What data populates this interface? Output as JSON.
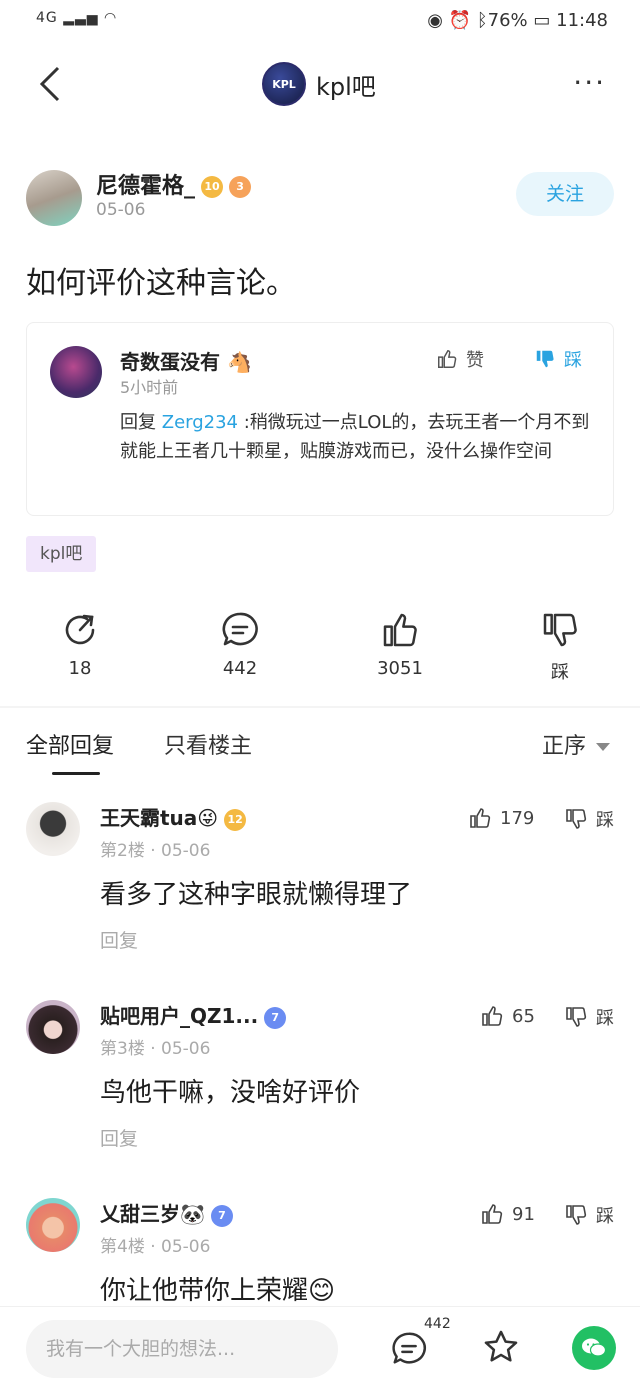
{
  "status_bar": {
    "signal": "4G",
    "battery": "76%",
    "time": "11:48"
  },
  "nav": {
    "title": "kpl吧",
    "logo_text": "KPL",
    "more": "···"
  },
  "post": {
    "author": "尼德霍格_",
    "level": "10",
    "level2": "3",
    "date": "05-06",
    "follow_label": "关注",
    "title": "如何评价这种言论。",
    "quote": {
      "author": "奇数蛋没有",
      "time": "5小时前",
      "like_label": "赞",
      "dislike_label": "踩",
      "reply_prefix": "回复 ",
      "mention": "Zerg234",
      "body": " :稍微玩过一点LOL的，去玩王者一个月不到就能上王者几十颗星，贴膜游戏而已，没什么操作空间"
    },
    "tag": "kpl吧",
    "actions": {
      "share": "18",
      "comments": "442",
      "likes": "3051",
      "dislike": "踩"
    }
  },
  "tabs": {
    "all": "全部回复",
    "owner_only": "只看楼主",
    "sort": "正序"
  },
  "comments": [
    {
      "name": "王天霸tua😜",
      "level": "12",
      "floor": "第2楼 · 05-06",
      "likes": "179",
      "dislike": "踩",
      "body": "看多了这种字眼就懒得理了",
      "reply": "回复"
    },
    {
      "name": "贴吧用户_QZ1...",
      "level": "7",
      "floor": "第3楼 · 05-06",
      "likes": "65",
      "dislike": "踩",
      "body": "鸟他干嘛，没啥好评价",
      "reply": "回复"
    },
    {
      "name": "乂甜三岁🐼",
      "level": "7",
      "floor": "第4楼 · 05-06",
      "likes": "91",
      "dislike": "踩",
      "body": "你让他带你上荣耀😊",
      "reply": ""
    }
  ],
  "bottom": {
    "placeholder": "我有一个大胆的想法...",
    "comment_count": "442"
  }
}
